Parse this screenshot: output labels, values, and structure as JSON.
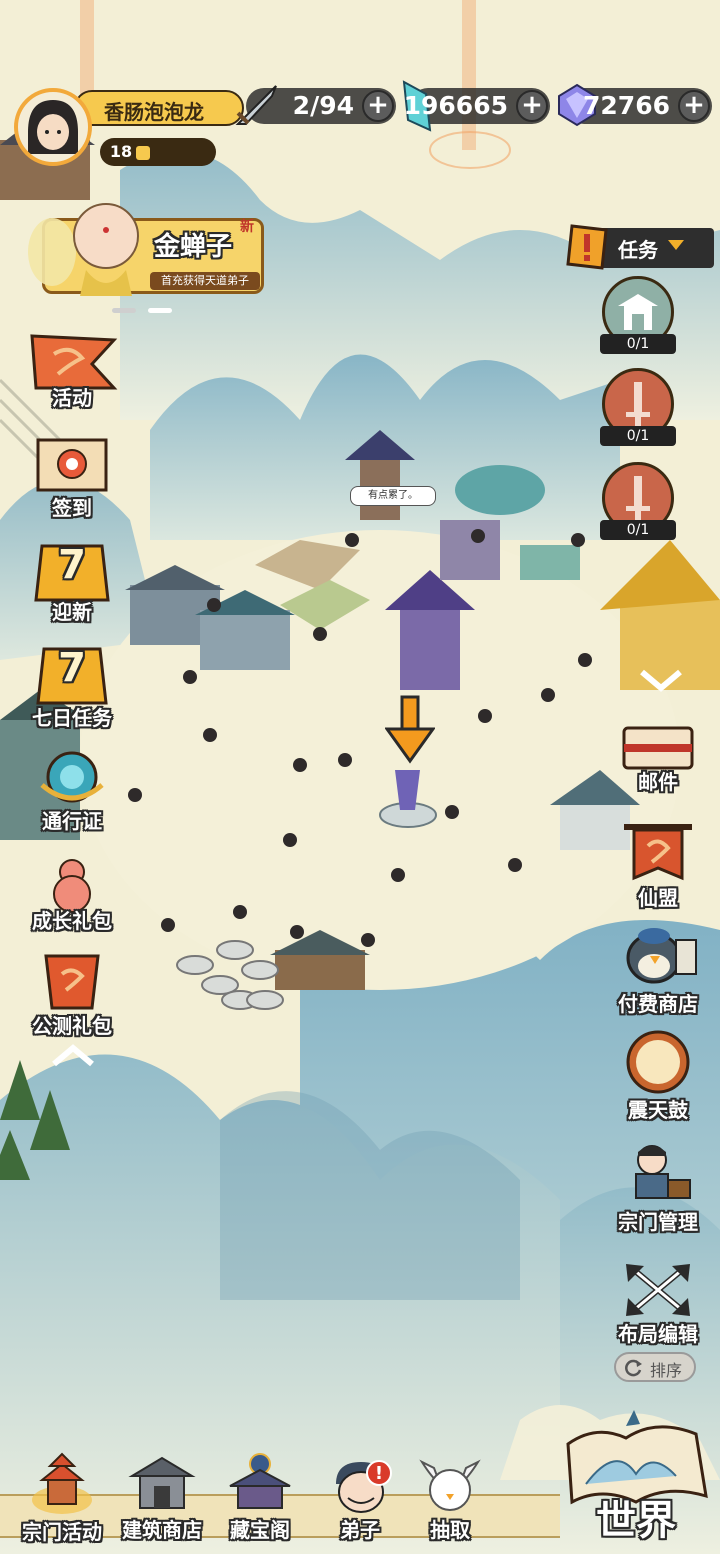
{
  "player": {
    "name": "香肠泡泡龙",
    "level": "18"
  },
  "resources": {
    "stamina": "2/94",
    "jade": "196665",
    "gem": "72766"
  },
  "promo": {
    "name": "金蝉子",
    "badge": "新",
    "subtitle": "首充获得天道弟子"
  },
  "bubble": "有点累了。",
  "left_menu": [
    {
      "label": "活动"
    },
    {
      "label": "签到"
    },
    {
      "label": "迎新",
      "badge": "7"
    },
    {
      "label": "七日任务",
      "badge": "7"
    },
    {
      "label": "通行证"
    },
    {
      "label": "成长礼包"
    },
    {
      "label": "公测礼包"
    }
  ],
  "tasks": {
    "label": "任务",
    "items": [
      {
        "progress": "0/1",
        "icon": "hall-icon"
      },
      {
        "progress": "0/1",
        "icon": "sword-icon"
      },
      {
        "progress": "0/1",
        "icon": "sword-icon"
      }
    ]
  },
  "right_menu": [
    {
      "label": "邮件"
    },
    {
      "label": "仙盟"
    },
    {
      "label": "付费商店"
    },
    {
      "label": "震天鼓"
    },
    {
      "label": "宗门管理"
    },
    {
      "label": "布局编辑"
    }
  ],
  "sort_label": "排序",
  "bottom_nav": [
    {
      "label": "宗门活动"
    },
    {
      "label": "建筑商店"
    },
    {
      "label": "藏宝阁"
    },
    {
      "label": "弟子",
      "alert": "!"
    },
    {
      "label": "抽取"
    }
  ],
  "world_label": "世界",
  "colors": {
    "sky": "#f3efd6",
    "mountain": "#a9cbd6",
    "mountain_dark": "#6f9fb3",
    "accent": "#f0b429",
    "task_circle": "#c9664a"
  }
}
